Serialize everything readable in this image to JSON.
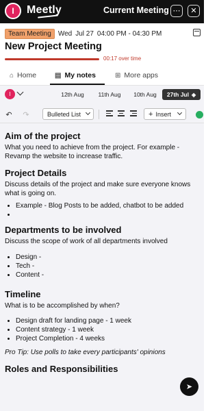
{
  "app": {
    "avatar_initial": "I",
    "brand": "Meetly",
    "header_title": "Current Meeting"
  },
  "meeting": {
    "tag": "Team Meeting",
    "day": "Wed",
    "date": "Jul 27",
    "time": "04:00 PM - 04:30 PM",
    "title": "New Project Meeting",
    "overtime_text": "00:17 over time",
    "progress_percent": 100
  },
  "tabs": [
    {
      "label": "Home",
      "icon": "home-icon"
    },
    {
      "label": "My notes",
      "icon": "notes-icon",
      "active": true
    },
    {
      "label": "More apps",
      "icon": "apps-grid-icon"
    }
  ],
  "notes_header": {
    "avatar_initial": "I",
    "dates": [
      "12th Aug",
      "11th Aug",
      "10th Aug",
      "27th Jul"
    ],
    "selected_date": "27th Jul"
  },
  "toolbar": {
    "list_style": "Bulleted List",
    "insert_label": "Insert"
  },
  "document": {
    "sections": [
      {
        "heading": "Aim of the project",
        "text": "What you need to achieve from the project. For example - Revamp the website to increase traffic.",
        "bullets": []
      },
      {
        "heading": "Project Details",
        "text": "Discuss details of the project and make sure everyone knows what is going on.",
        "bullets": [
          "Example - Blog Posts to be added, chatbot to be added",
          ""
        ]
      },
      {
        "heading": "Departments to be involved",
        "text": "Discuss the scope of work of all departments involved",
        "bullets": [
          "Design -",
          "Tech -",
          "Content -"
        ]
      },
      {
        "heading": "Timeline",
        "text": "What is to be accomplished by when?",
        "bullets": [
          "Design draft for landing page - 1 week",
          "Content strategy - 1 week",
          "Project Completion - 4 weeks"
        ]
      }
    ],
    "tip": "Pro Tip: Use polls to take every participants' opinions",
    "last_heading": "Roles and Responsibilities"
  },
  "colors": {
    "accent_red": "#c0392b",
    "tag_orange": "#f0a06a",
    "avatar_pink": "#e0245e",
    "topbar": "#111111",
    "saved_green": "#27ae60"
  }
}
